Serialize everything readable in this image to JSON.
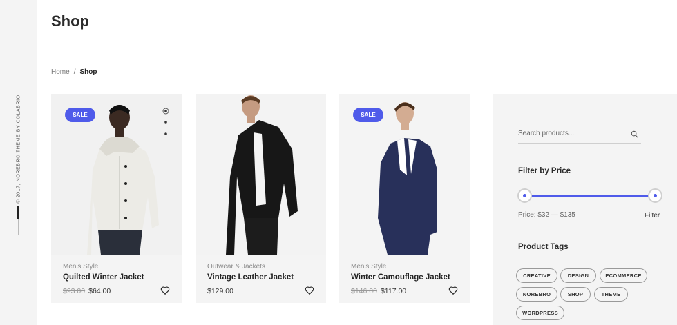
{
  "side": {
    "credit": "© 2017, NOREBRO THEME BY COLABRIO"
  },
  "page": {
    "title": "Shop"
  },
  "breadcrumb": {
    "home": "Home",
    "separator": "/",
    "current": "Shop"
  },
  "products": [
    {
      "category": "Men's Style",
      "name": "Quilted Winter Jacket",
      "old_price": "$93.00",
      "price": "$64.00",
      "sale_label": "SALE"
    },
    {
      "category": "Outwear & Jackets",
      "name": "Vintage Leather Jacket",
      "price": "$129.00"
    },
    {
      "category": "Men's Style",
      "name": "Winter Camouflage Jacket",
      "old_price": "$146.00",
      "price": "$117.00",
      "sale_label": "SALE"
    }
  ],
  "sidebar": {
    "search": {
      "placeholder": "Search products..."
    },
    "filter": {
      "title": "Filter by Price",
      "price_label": "Price: $32 — $135",
      "button": "Filter",
      "min": 32,
      "max": 135
    },
    "tags": {
      "title": "Product Tags",
      "items": [
        "CREATIVE",
        "DESIGN",
        "ECOMMERCE",
        "NOREBRO",
        "SHOP",
        "THEME",
        "WORDPRESS"
      ]
    }
  },
  "colors": {
    "accent": "#4f5bea",
    "panel": "#f4f4f4"
  }
}
